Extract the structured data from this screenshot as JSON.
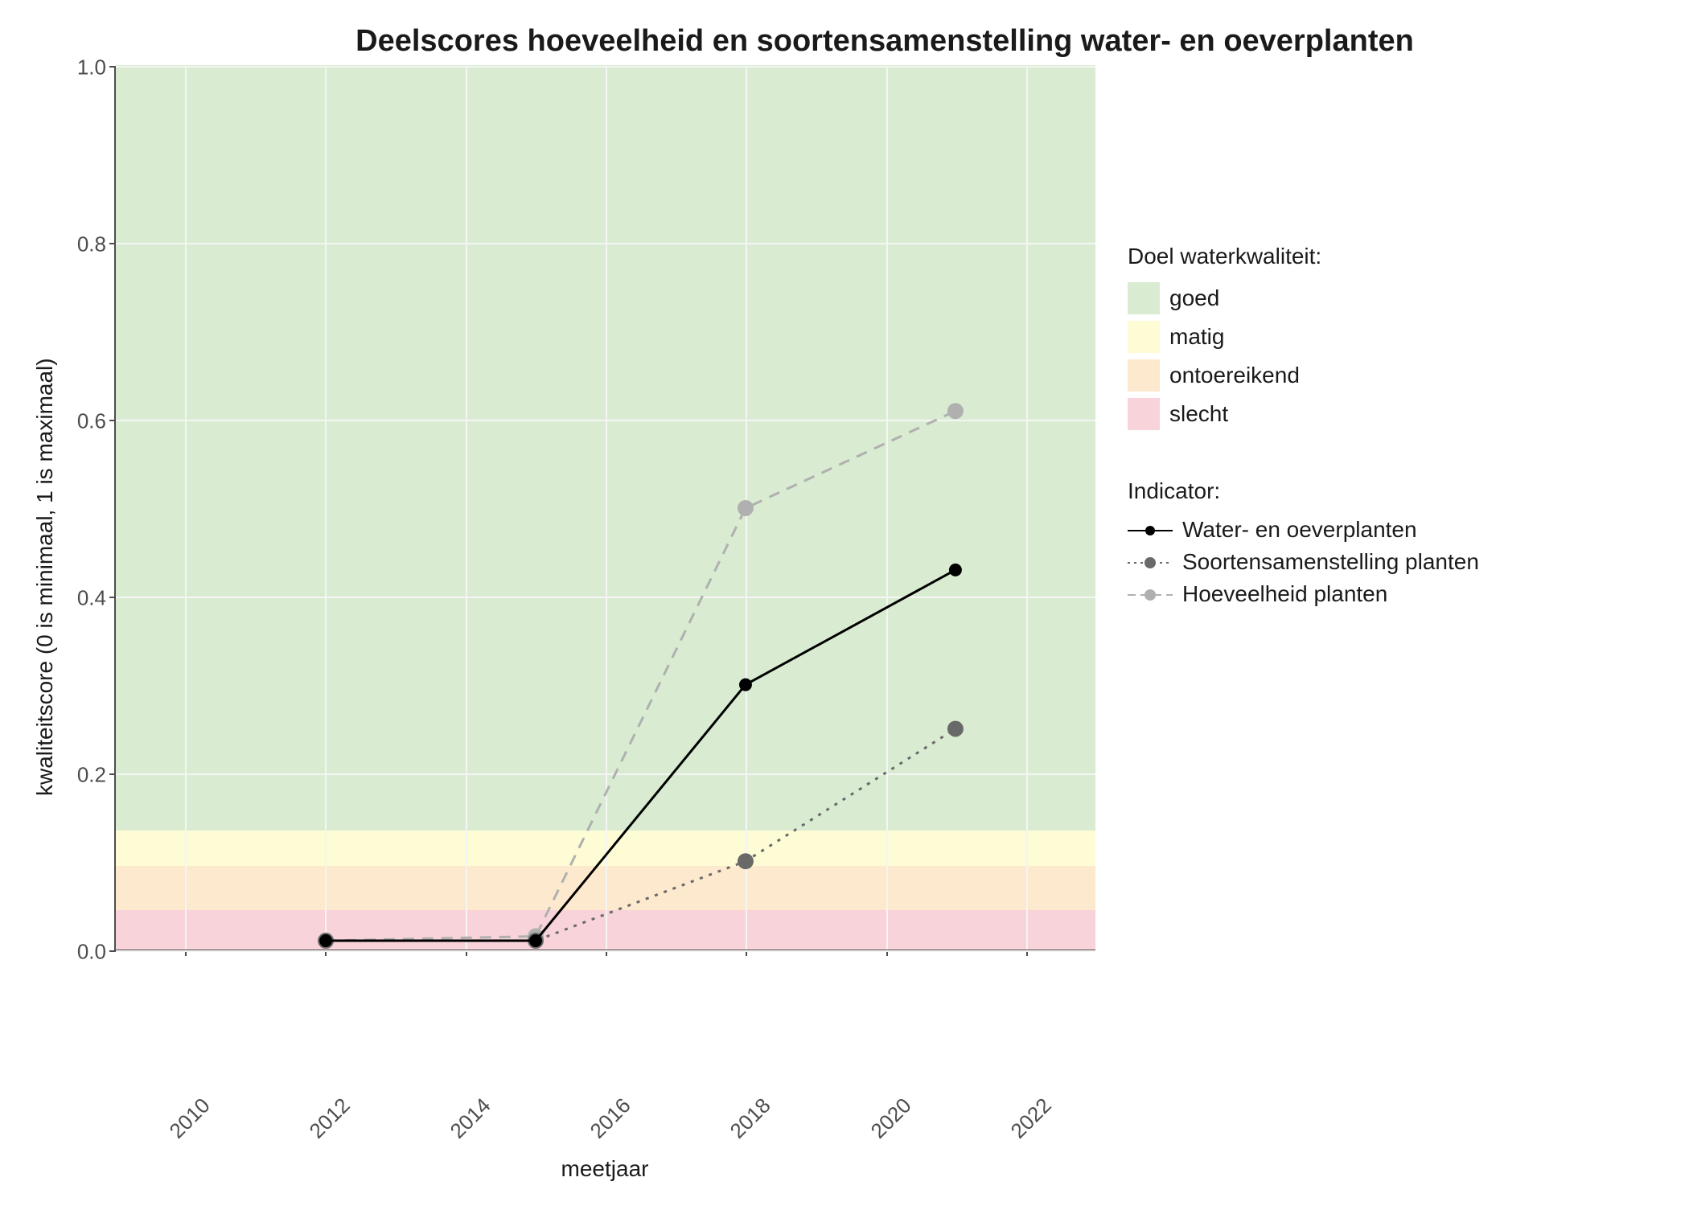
{
  "title": "Deelscores hoeveelheid en soortensamenstelling water- en oeverplanten",
  "ylabel": "kwaliteitscore (0 is minimaal, 1 is maximaal)",
  "xlabel": "meetjaar",
  "yticks": [
    "0.0",
    "0.2",
    "0.4",
    "0.6",
    "0.8",
    "1.0"
  ],
  "xticks": [
    "2010",
    "2012",
    "2014",
    "2016",
    "2018",
    "2020",
    "2022"
  ],
  "legend_bands_title": "Doel waterkwaliteit:",
  "legend_bands": {
    "goed": "goed",
    "matig": "matig",
    "ontoereikend": "ontoereikend",
    "slecht": "slecht"
  },
  "legend_series_title": "Indicator:",
  "legend_series": {
    "water_oever": "Water- en oeverplanten",
    "soort": "Soortensamenstelling planten",
    "hoeveel": "Hoeveelheid planten"
  },
  "chart_data": {
    "type": "line",
    "title": "Deelscores hoeveelheid en soortensamenstelling water- en oeverplanten",
    "xlabel": "meetjaar",
    "ylabel": "kwaliteitscore (0 is minimaal, 1 is maximaal)",
    "xlim": [
      2009,
      2023
    ],
    "ylim": [
      0,
      1
    ],
    "xticks": [
      2010,
      2012,
      2014,
      2016,
      2018,
      2020,
      2022
    ],
    "yticks": [
      0.0,
      0.2,
      0.4,
      0.6,
      0.8,
      1.0
    ],
    "bands": [
      {
        "name": "slecht",
        "ymin": 0.0,
        "ymax": 0.045,
        "color": "#f8d3d9"
      },
      {
        "name": "ontoereikend",
        "ymin": 0.045,
        "ymax": 0.095,
        "color": "#fde9cd"
      },
      {
        "name": "matig",
        "ymin": 0.095,
        "ymax": 0.135,
        "color": "#fdfcd5"
      },
      {
        "name": "goed",
        "ymin": 0.135,
        "ymax": 1.0,
        "color": "#d9ecd1"
      }
    ],
    "x": [
      2012,
      2015,
      2018,
      2021
    ],
    "series": [
      {
        "name": "Water- en oeverplanten",
        "values": [
          0.01,
          0.01,
          0.3,
          0.43
        ],
        "color": "#000000",
        "dash": "solid"
      },
      {
        "name": "Soortensamenstelling planten",
        "values": [
          0.01,
          0.01,
          0.1,
          0.25
        ],
        "color": "#696969",
        "dash": "dot"
      },
      {
        "name": "Hoeveelheid planten",
        "values": [
          0.01,
          0.015,
          0.5,
          0.61
        ],
        "color": "#b0b0b0",
        "dash": "dash"
      }
    ]
  }
}
